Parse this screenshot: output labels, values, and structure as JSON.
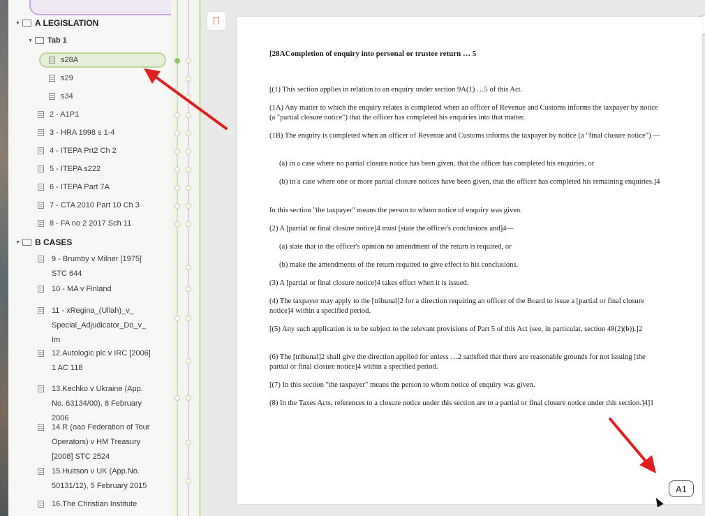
{
  "sidebar": {
    "sections": [
      {
        "label": "A LEGISLATION"
      },
      {
        "label": "B CASES"
      }
    ],
    "tab1": {
      "label": "Tab 1"
    },
    "items": [
      {
        "label": "s28A"
      },
      {
        "label": "s29"
      },
      {
        "label": "s34"
      },
      {
        "label": "2 - A1P1"
      },
      {
        "label": "3 - HRA 1998 s 1-4"
      },
      {
        "label": "4 - ITEPA Prt2 Ch 2"
      },
      {
        "label": "5 - ITEPA s222"
      },
      {
        "label": "6 - ITEPA Part 7A"
      },
      {
        "label": "7 - CTA 2010 Part 10 Ch 3"
      },
      {
        "label": "8 - FA no 2 2017 Sch 11"
      }
    ],
    "cases": [
      {
        "line1": "9 - Brumby v Milner [1975]",
        "line2": "STC 644",
        "line3": ""
      },
      {
        "line1": "10 - MA v Finland",
        "line2": "",
        "line3": ""
      },
      {
        "line1": "11 - xRegina_(Ullah)_v_",
        "line2": "Special_Adjudicator_Do_v_",
        "line3": "Im"
      },
      {
        "line1": "12.Autologic plc v IRC [2006]",
        "line2": "1 AC 118",
        "line3": ""
      },
      {
        "line1": "13.Kechko v Ukraine (App.",
        "line2": "No. 63134/00), 8 February",
        "line3": "2006"
      },
      {
        "line1": "14.R (oao Federation of Tour",
        "line2": "Operators) v HM Treasury",
        "line3": "[2008] STC 2524"
      },
      {
        "line1": "15.Huitson v UK (App.No.",
        "line2": "50131/12), 5 February 2015",
        "line3": ""
      },
      {
        "line1": "16.The Christian Institute",
        "line2": "",
        "line3": ""
      }
    ]
  },
  "document": {
    "title": "[28ACompletion of enquiry into personal or trustee return … 5",
    "paragraphs": [
      {
        "text": "[(1)    This section applies in relation to an enquiry under section 9A(1) …5 of this Act."
      },
      {
        "text": "(1A)    Any matter to which the enquiry relates is completed when an officer of Revenue and Customs informs the taxpayer by notice (a \"partial closure notice\") that the officer has completed his enquiries into that matter."
      },
      {
        "text": "(1B)    The enquiry is completed when an officer of Revenue and Customs informs the taxpayer by notice (a \"final closure notice\") —"
      },
      {
        "text": "(a)    in a case where no partial closure notice has been given, that the officer has completed his enquiries, or"
      },
      {
        "text": "(b)    in a case where one or more partial closure notices have been given, that the officer has completed his remaining enquiries.]4"
      },
      {
        "text": "In this section \"the taxpayer\" means the person to whom notice of enquiry was given."
      },
      {
        "text": "(2)    A [partial or final closure notice]4 must [state the officer's conclusions and]4—"
      },
      {
        "text": "(a)    state that in the officer's opinion no amendment of the return is required, or"
      },
      {
        "text": "(b)    make the amendments of the return required to give effect to his conclusions."
      },
      {
        "text": "(3)    A [partial or final closure notice]4 takes effect when it is issued."
      },
      {
        "text": "(4)    The taxpayer may apply to the [tribunal]2 for a direction requiring an officer of the Board to issue a [partial or final closure notice]4 within a specified period."
      },
      {
        "text": "[(5)    Any such application is to be subject to the relevant provisions of Part 5 of this Act (see, in particular, section 48(2)(b)).]2"
      },
      {
        "text": "(6)    The [tribunal]2 shall give the direction applied for unless …2 satisfied that there are reasonable grounds for not issuing [the partial or final closure notice]4 within a specified period."
      },
      {
        "text": "[(7)    In this section \"the taxpayer\" means the person to whom notice of enquiry was given."
      },
      {
        "text": "(8)    In the Taxes Acts, references to a closure notice under this section are to a partial or final closure notice under this section.]4]1"
      }
    ]
  },
  "page_label": "A1",
  "colors": {
    "selection": "#e6f0d9",
    "timeline_green": "#8fc46a",
    "timeline_purple": "#c9a8e0",
    "annotation_arrow": "#e02020"
  }
}
